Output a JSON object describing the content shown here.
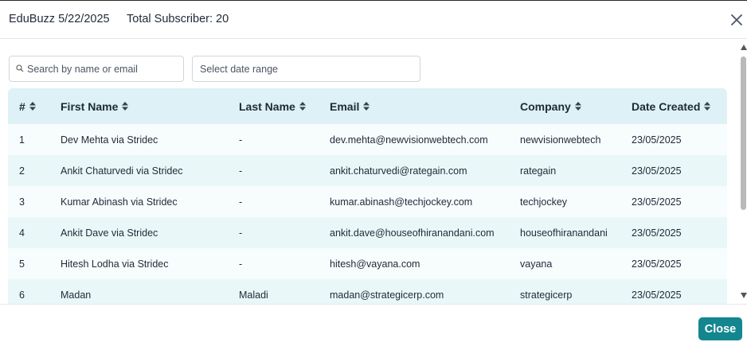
{
  "header": {
    "title": "EduBuzz 5/22/2025",
    "subscribers": "Total Subscriber: 20"
  },
  "filters": {
    "search_placeholder": "Search by name or email",
    "date_placeholder": "Select date range"
  },
  "table": {
    "columns": [
      "#",
      "First Name",
      "Last Name",
      "Email",
      "Company",
      "Date Created"
    ],
    "rows": [
      {
        "num": "1",
        "first": "Dev Mehta via Stridec",
        "last": "-",
        "email": "dev.mehta@newvisionwebtech.com",
        "company": "newvisionwebtech",
        "date": "23/05/2025"
      },
      {
        "num": "2",
        "first": "Ankit Chaturvedi via Stridec",
        "last": "-",
        "email": "ankit.chaturvedi@rategain.com",
        "company": "rategain",
        "date": "23/05/2025"
      },
      {
        "num": "3",
        "first": "Kumar Abinash via Stridec",
        "last": "-",
        "email": "kumar.abinash@techjockey.com",
        "company": "techjockey",
        "date": "23/05/2025"
      },
      {
        "num": "4",
        "first": "Ankit Dave via Stridec",
        "last": "-",
        "email": "ankit.dave@houseofhiranandani.com",
        "company": "houseofhiranandani",
        "date": "23/05/2025"
      },
      {
        "num": "5",
        "first": "Hitesh Lodha via Stridec",
        "last": "-",
        "email": "hitesh@vayana.com",
        "company": "vayana",
        "date": "23/05/2025"
      },
      {
        "num": "6",
        "first": "Madan",
        "last": "Maladi",
        "email": "madan@strategicerp.com",
        "company": "strategicerp",
        "date": "23/05/2025"
      }
    ]
  },
  "footer": {
    "close_label": "Close"
  },
  "colors": {
    "accent": "#13868f",
    "header_row": "#ddf1f6",
    "row_odd": "#f7fcfd",
    "row_even": "#eaf7f8"
  }
}
